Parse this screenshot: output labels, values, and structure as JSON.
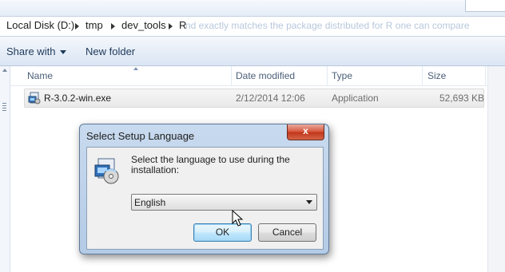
{
  "explorer": {
    "breadcrumb": [
      "Local Disk (D:)",
      "tmp",
      "dev_tools",
      "R"
    ],
    "address_ghost_text": "nd exactly matches the package distributed for R   one can compare",
    "toolbar": {
      "share_label": "Share with",
      "new_folder_label": "New folder"
    },
    "columns": {
      "name": "Name",
      "date": "Date modified",
      "type": "Type",
      "size": "Size"
    },
    "files": [
      {
        "name": "R-3.0.2-win.exe",
        "date": "2/12/2014 12:06",
        "type": "Application",
        "size": "52,693 KB",
        "icon": "installer-icon"
      }
    ]
  },
  "dialog": {
    "title": "Select Setup Language",
    "close_label": "x",
    "instruction": "Select the language to use during the installation:",
    "language_selected": "English",
    "ok_label": "OK",
    "cancel_label": "Cancel",
    "icon": "setup-disc-icon"
  },
  "colors": {
    "toolbar_bg": "#dbe5f3",
    "dialog_frame": "#b4cbe6",
    "close_red": "#c1361c",
    "ok_highlight": "#bee6fd"
  }
}
